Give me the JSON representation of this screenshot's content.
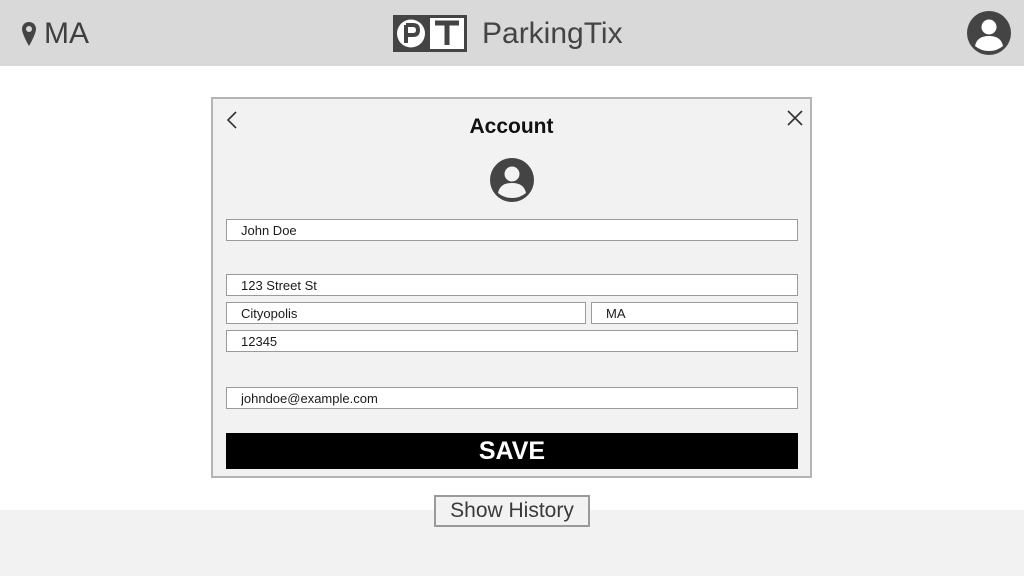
{
  "header": {
    "location_icon": "map-pin-icon",
    "location": "MA",
    "logo_letters": "PT",
    "app_name": "ParkingTix",
    "user_icon": "user-account-icon"
  },
  "dialog": {
    "back_icon": "chevron-left-icon",
    "close_icon": "close-icon",
    "title": "Account",
    "avatar_icon": "user-avatar-icon",
    "fields": {
      "name": "John Doe",
      "street": "123 Street St",
      "city": "Cityopolis",
      "state": "MA",
      "zip": "12345",
      "email": "johndoe@example.com"
    },
    "save_label": "SAVE"
  },
  "show_history_label": "Show History"
}
